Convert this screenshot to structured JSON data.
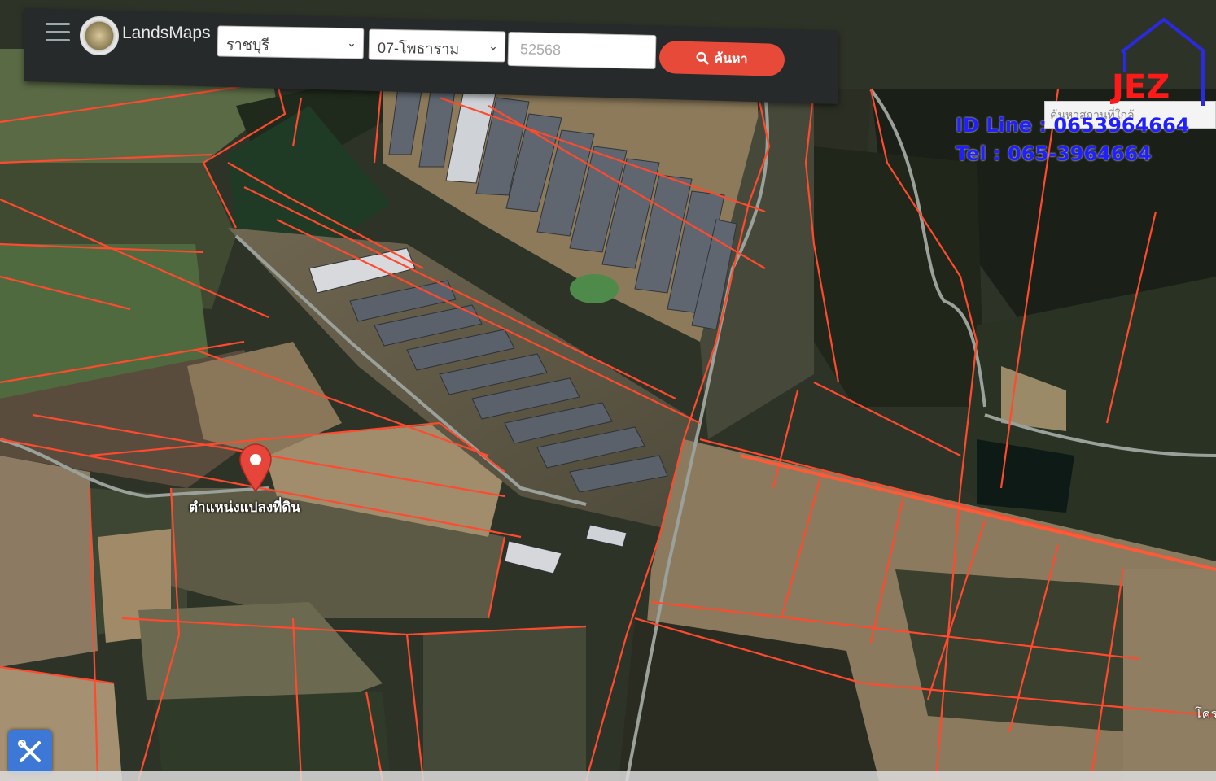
{
  "app": {
    "name": "LandsMaps"
  },
  "search": {
    "province": "ราชบุรี",
    "district": "07-โพธาราม",
    "parcel_number": "52568",
    "button_label": "ค้นหา"
  },
  "right_panel": {
    "search_box_text": "ค้นหาสถานที่ใกล้"
  },
  "watermark": {
    "logo_text": "JEZ",
    "id_line": "ID Line : 0653964664",
    "tel": "Tel : 065-3964664"
  },
  "map": {
    "marker_label": "ตำแหน่งแปลงที่ดิน",
    "place_label": "โคร",
    "parcel_line_color": "#ff4a2e",
    "marker_color": "#e8453a"
  },
  "icons": [
    "menu-icon",
    "search-icon",
    "map-pin-icon",
    "tools-icon"
  ],
  "colors": {
    "accent": "#e84a3a",
    "watermark_blue": "#1f1fff",
    "watermark_red": "#ff1a1a"
  }
}
